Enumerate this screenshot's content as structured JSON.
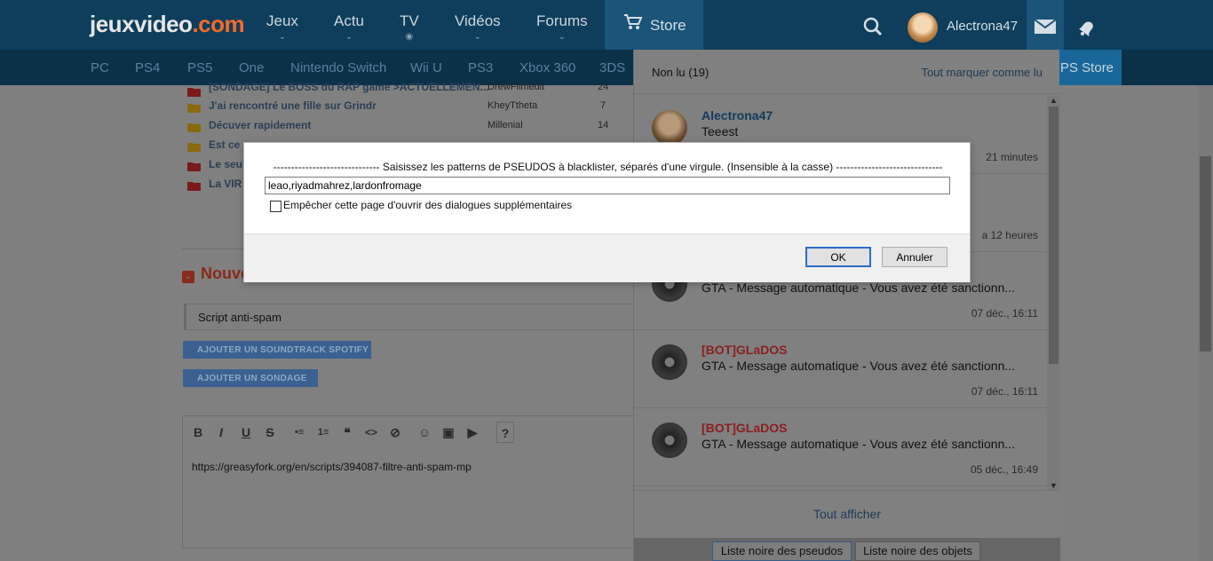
{
  "header": {
    "logo_main": "jeuxvideo",
    "logo_accent": ".com",
    "nav": [
      {
        "label": "Jeux",
        "marker": "⌄"
      },
      {
        "label": "Actu",
        "marker": "⌄"
      },
      {
        "label": "TV",
        "marker": "◉"
      },
      {
        "label": "Vidéos",
        "marker": "⌄"
      },
      {
        "label": "Forums",
        "marker": "⌄"
      }
    ],
    "store_label": "Store",
    "username": "Alectrona47"
  },
  "platforms": [
    "PC",
    "PS4",
    "PS5",
    "One",
    "Nintendo Switch",
    "Wii U",
    "PS3",
    "Xbox 360",
    "3DS"
  ],
  "ps_store_label": "PS Store",
  "forum": {
    "topics": [
      {
        "title": "[SONDAGE] Le BOSS du RAP game >ACTUELLEMEN...",
        "author": "DrewFilmedit",
        "count": "24"
      },
      {
        "title": "J'ai rencontré une fille sur Grindr",
        "author": "KheyTtheta",
        "count": "7"
      },
      {
        "title": "Décuver rapidement",
        "author": "Millenial",
        "count": "14"
      },
      {
        "title": "Est ce",
        "author": "",
        "count": ""
      },
      {
        "title": "Le seul",
        "author": "",
        "count": ""
      },
      {
        "title": "La VIR",
        "author": "",
        "count": ""
      }
    ],
    "section_title": "Nouveau",
    "subject_value": "Script anti-spam",
    "spotify_button": "AJOUTER UN SOUNDTRACK SPOTIFY",
    "poll_button": "AJOUTER UN SONDAGE",
    "toolbar": [
      "B",
      "I",
      "U",
      "S",
      "•≡",
      "1≡",
      "❝",
      "<>",
      "⊘",
      "☺",
      "▣",
      "▶",
      "?"
    ],
    "editor_text": "https://greasyfork.org/en/scripts/394087-filtre-anti-spam-mp"
  },
  "notifications": {
    "unread_label": "Non lu (19)",
    "mark_all_label": "Tout marquer comme lu",
    "items": [
      {
        "sender": "Alectrona47",
        "message": "Teeest",
        "time": "21 minutes",
        "sender_color": "#173a5c"
      },
      {
        "sender": "",
        "message": "",
        "time": "a 12 heures",
        "sender_color": "#8a1f1f"
      },
      {
        "sender": "",
        "message": "GTA - Message automatique - Vous avez été sanctionn...",
        "time": "07 déc., 16:11",
        "sender_color": "#8a1f1f"
      },
      {
        "sender": "[BOT]GLaDOS",
        "message": "GTA - Message automatique - Vous avez été sanctionn...",
        "time": "07 déc., 16:11",
        "sender_color": "#8a1f1f"
      },
      {
        "sender": "[BOT]GLaDOS",
        "message": "GTA - Message automatique - Vous avez été sanctionn...",
        "time": "05 déc., 16:49",
        "sender_color": "#8a1f1f"
      }
    ],
    "show_all_label": "Tout afficher",
    "blacklist_pseudos_label": "Liste noire des pseudos",
    "blacklist_objects_label": "Liste noire des objets"
  },
  "dialog": {
    "message": "------------------------------ Saisissez les patterns de PSEUDOS à blacklister, séparés d'une virgule. (Insensible à la casse) ------------------------------",
    "input_value": "leao,riyadmahrez,lardonfromage",
    "checkbox_label": "Empêcher cette page d'ouvrir des dialogues supplémentaires",
    "ok_label": "OK",
    "cancel_label": "Annuler"
  }
}
